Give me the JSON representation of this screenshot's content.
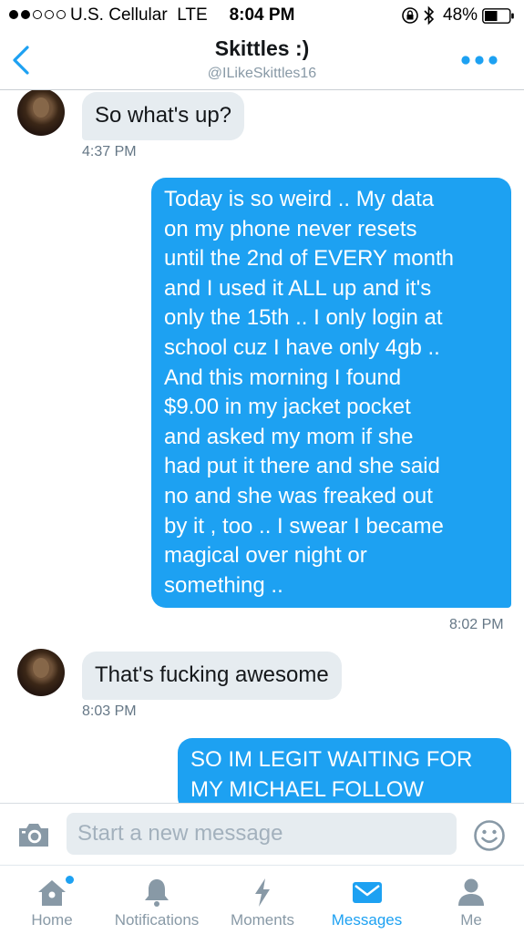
{
  "status_bar": {
    "carrier": "U.S. Cellular",
    "network": "LTE",
    "time": "8:04 PM",
    "battery": "48%",
    "signal_bars": 2,
    "signal_total": 5
  },
  "header": {
    "title": "Skittles :)",
    "handle": "@ILikeSkittles16",
    "back_icon": "chevron-left-icon",
    "more_icon": "more-dots-icon"
  },
  "messages": [
    {
      "direction": "incoming",
      "text": "So what's up?",
      "time": "4:37 PM"
    },
    {
      "direction": "outgoing",
      "lines": [
        "Today is so weird .. My data",
        "on my phone never resets",
        "until the 2nd of EVERY month",
        "and I used it ALL up and it's",
        "only the 15th .. I only login at",
        "school cuz I have only 4gb ..",
        "And this morning I found",
        "$9.00 in my jacket pocket",
        "and asked my mom if she",
        "had put it there and she said",
        "no and she was freaked out",
        "by it , too .. I swear I became",
        "magical over night or",
        "something .."
      ],
      "time": "8:02 PM"
    },
    {
      "direction": "incoming",
      "text": "That's fucking awesome",
      "time": "8:03 PM"
    },
    {
      "direction": "outgoing",
      "lines": [
        "SO IM LEGIT WAITING FOR",
        "MY MICHAEL FOLLOW"
      ]
    }
  ],
  "composer": {
    "placeholder": "Start a new message",
    "camera_icon": "camera-icon",
    "emoji_icon": "emoji-icon"
  },
  "tabs": [
    {
      "label": "Home",
      "icon": "home-icon",
      "active": false,
      "badge": true
    },
    {
      "label": "Notifications",
      "icon": "bell-icon",
      "active": false
    },
    {
      "label": "Moments",
      "icon": "lightning-icon",
      "active": false
    },
    {
      "label": "Messages",
      "icon": "envelope-icon",
      "active": true
    },
    {
      "label": "Me",
      "icon": "person-icon",
      "active": false
    }
  ],
  "colors": {
    "accent": "#1da1f2",
    "incoming_bubble": "#e6ecf0",
    "muted_text": "#8899a6"
  }
}
